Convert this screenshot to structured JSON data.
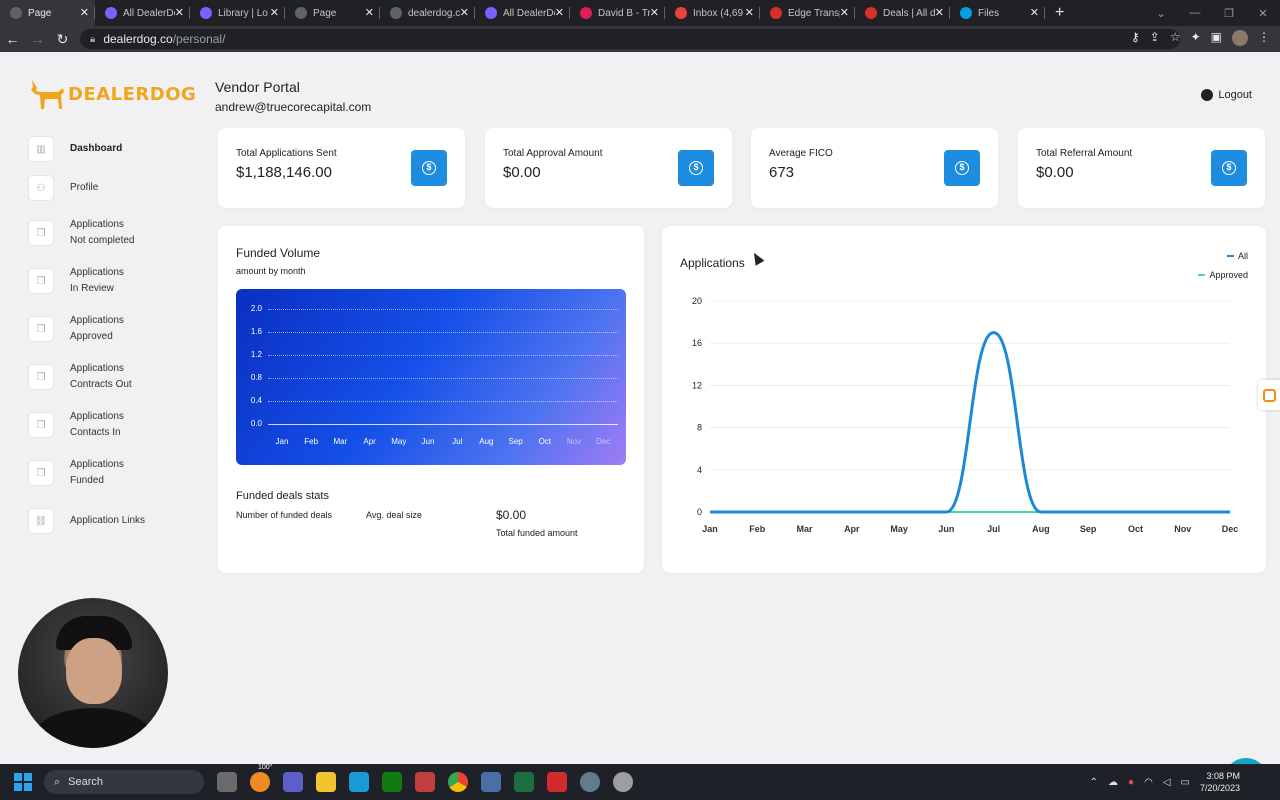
{
  "browser": {
    "tabs": [
      {
        "label": "Page",
        "icon": "gear-icon",
        "color": "#5f6368"
      },
      {
        "label": "All DealerDog",
        "icon": "dealerdog-icon",
        "color": "#7b61ff"
      },
      {
        "label": "Library | Lo",
        "icon": "dealerdog-icon",
        "color": "#7b61ff"
      },
      {
        "label": "Page",
        "icon": "gear-icon",
        "color": "#5f6368"
      },
      {
        "label": "dealerdog.c",
        "icon": "globe-icon",
        "color": "#5f6368"
      },
      {
        "label": "All DealerDo",
        "icon": "dealerdog-icon",
        "color": "#7b61ff"
      },
      {
        "label": "David B - Tr",
        "icon": "slack-icon",
        "color": "#e01e5a"
      },
      {
        "label": "Inbox (4,69",
        "icon": "gmail-icon",
        "color": "#ea4335"
      },
      {
        "label": "Edge Transp",
        "icon": "pipedrive-icon",
        "color": "#d93025"
      },
      {
        "label": "Deals | All d",
        "icon": "pipedrive-icon",
        "color": "#d93025"
      },
      {
        "label": "Files",
        "icon": "salesforce-icon",
        "color": "#00a1e0"
      }
    ],
    "url_domain": "dealerdog.co",
    "url_path": "/personal/"
  },
  "app": {
    "logo_text": "DEALERDOG",
    "brand_color": "#f2a51a",
    "portal_title": "Vendor Portal",
    "user_email": "andrew@truecorecapital.com",
    "logout_label": "Logout"
  },
  "sidebar": {
    "items": [
      {
        "line1": "Dashboard",
        "line2": "",
        "icon": "chart-icon"
      },
      {
        "line1": "Profile",
        "line2": "",
        "icon": "user-icon"
      },
      {
        "line1": "Applications",
        "line2": "Not completed",
        "icon": "document-icon"
      },
      {
        "line1": "Applications",
        "line2": "In Review",
        "icon": "document-icon"
      },
      {
        "line1": "Applications",
        "line2": "Approved",
        "icon": "document-icon"
      },
      {
        "line1": "Applications",
        "line2": "Contracts Out",
        "icon": "document-icon"
      },
      {
        "line1": "Applications",
        "line2": "Contacts In",
        "icon": "document-icon"
      },
      {
        "line1": "Applications",
        "line2": "Funded",
        "icon": "document-icon"
      },
      {
        "line1": "Application Links",
        "line2": "",
        "icon": "link-icon"
      }
    ]
  },
  "stats": [
    {
      "label": "Total Applications Sent",
      "value": "$1,188,146.00"
    },
    {
      "label": "Total Approval Amount",
      "value": "$0.00"
    },
    {
      "label": "Average FICO",
      "value": "673"
    },
    {
      "label": "Total Referral Amount",
      "value": "$0.00"
    }
  ],
  "funded": {
    "title": "Funded Volume",
    "subtitle": "amount by month",
    "stats_title": "Funded deals stats",
    "num_deals_label": "Number of funded deals",
    "avg_size_label": "Avg. deal size",
    "total_value": "$0.00",
    "total_label": "Total funded amount"
  },
  "applications_chart": {
    "title": "Applications"
  },
  "chart_data": [
    {
      "type": "area",
      "title": "Funded Volume",
      "subtitle": "amount by month",
      "categories": [
        "Jan",
        "Feb",
        "Mar",
        "Apr",
        "May",
        "Jun",
        "Jul",
        "Aug",
        "Sep",
        "Oct",
        "Nov",
        "Dec"
      ],
      "yticks": [
        "2.0",
        "1.6",
        "1.2",
        "0.8",
        "0.4",
        "0.0"
      ],
      "values": [
        0,
        0,
        0,
        0,
        0,
        0,
        0,
        0,
        0,
        0,
        0,
        0
      ],
      "ylim": [
        0,
        2.0
      ],
      "grid": true
    },
    {
      "type": "line",
      "title": "Applications",
      "categories": [
        "Jan",
        "Feb",
        "Mar",
        "Apr",
        "May",
        "Jun",
        "Jul",
        "Aug",
        "Sep",
        "Oct",
        "Nov",
        "Dec"
      ],
      "yticks": [
        "20",
        "16",
        "12",
        "8",
        "4",
        "0"
      ],
      "ylim": [
        0,
        20
      ],
      "grid": true,
      "legend": "top-right",
      "series": [
        {
          "name": "All",
          "color": "#1e88d8",
          "values": [
            0,
            0,
            0,
            0,
            0,
            0,
            17,
            0,
            0,
            0,
            0,
            0
          ]
        },
        {
          "name": "Approved",
          "color": "#3ddc97",
          "values": [
            0,
            0,
            0,
            0,
            0,
            0,
            0,
            0,
            0,
            0,
            0,
            0
          ]
        }
      ]
    }
  ],
  "taskbar": {
    "search_label": "Search",
    "weather_badge": "100°",
    "time": "3:08 PM",
    "date": "7/20/2023"
  }
}
